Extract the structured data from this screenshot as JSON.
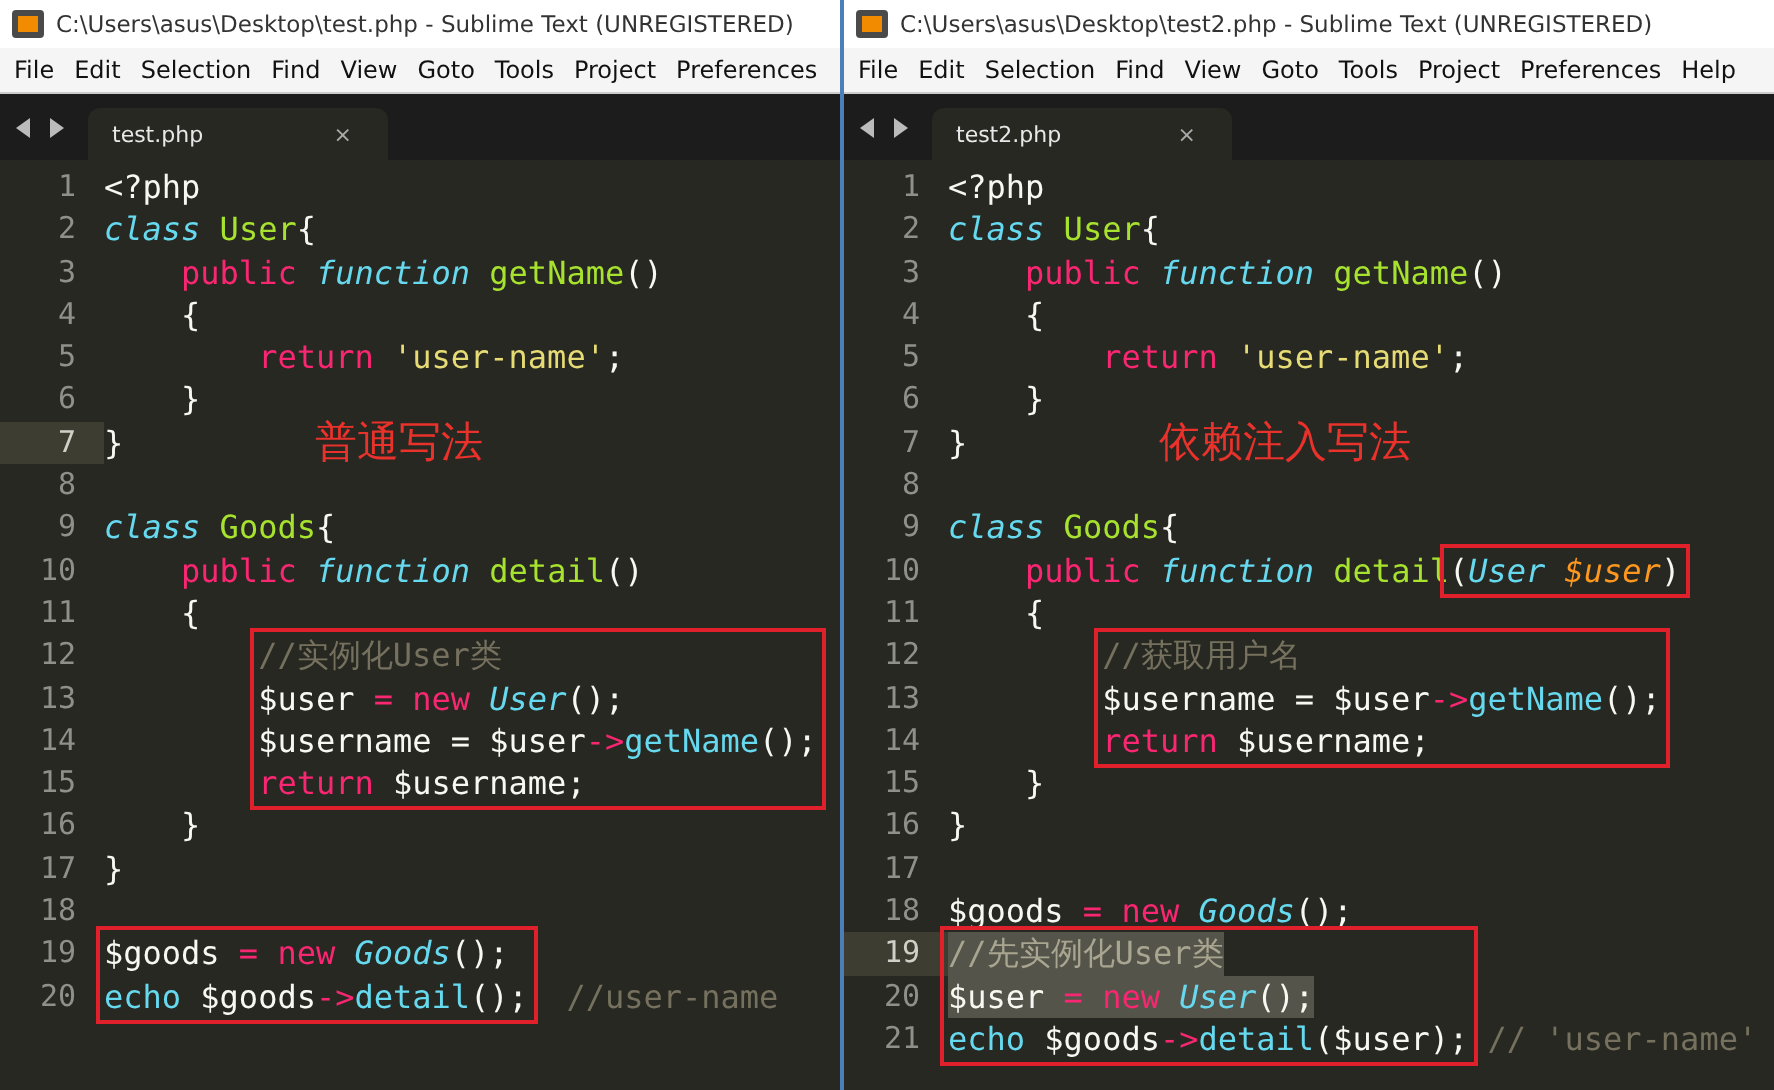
{
  "windows": [
    {
      "title": "C:\\Users\\asus\\Desktop\\test.php - Sublime Text (UNREGISTERED)",
      "menu": [
        "File",
        "Edit",
        "Selection",
        "Find",
        "View",
        "Goto",
        "Tools",
        "Project",
        "Preferences"
      ],
      "tab": {
        "label": "test.php",
        "close": "×",
        "selected": true
      },
      "lines": [
        {
          "number": "1",
          "current": false,
          "selected": false,
          "tokens": [
            {
              "kind": "plain",
              "text": "<?php"
            }
          ]
        },
        {
          "number": "2",
          "current": false,
          "selected": false,
          "tokens": [
            {
              "kind": "storage",
              "text": "class"
            },
            {
              "kind": "entity",
              "text": " User"
            },
            {
              "kind": "plain",
              "text": "{"
            }
          ]
        },
        {
          "number": "3",
          "current": false,
          "selected": false,
          "tokens": [
            {
              "kind": "keyword",
              "text": "    public"
            },
            {
              "kind": "storage",
              "text": " function"
            },
            {
              "kind": "entity",
              "text": " getName"
            },
            {
              "kind": "plain",
              "text": "()"
            }
          ]
        },
        {
          "number": "4",
          "current": false,
          "selected": false,
          "tokens": [
            {
              "kind": "plain",
              "text": "    {"
            }
          ]
        },
        {
          "number": "5",
          "current": false,
          "selected": false,
          "tokens": [
            {
              "kind": "keyword",
              "text": "        return"
            },
            {
              "kind": "string",
              "text": " 'user-name'"
            },
            {
              "kind": "plain",
              "text": ";"
            }
          ]
        },
        {
          "number": "6",
          "current": false,
          "selected": false,
          "tokens": [
            {
              "kind": "plain",
              "text": "    }"
            }
          ]
        },
        {
          "number": "7",
          "current": true,
          "selected": false,
          "tokens": [
            {
              "kind": "plain",
              "text": "}"
            }
          ],
          "note": "普通写法"
        },
        {
          "number": "8",
          "current": false
        },
        {
          "number": "9",
          "current": false,
          "selected": false,
          "tokens": [
            {
              "kind": "storage",
              "text": "class"
            },
            {
              "kind": "entity",
              "text": " Goods"
            },
            {
              "kind": "plain",
              "text": "{"
            }
          ]
        },
        {
          "number": "10",
          "current": false,
          "selected": false,
          "tokens": [
            {
              "kind": "keyword",
              "text": "    public"
            },
            {
              "kind": "storage",
              "text": " function"
            },
            {
              "kind": "entity",
              "text": " detail"
            },
            {
              "kind": "plain",
              "text": "()"
            }
          ]
        },
        {
          "number": "11",
          "current": false,
          "selected": false,
          "tokens": [
            {
              "kind": "plain",
              "text": "    {"
            }
          ]
        },
        {
          "number": "12",
          "current": false,
          "selected": false,
          "tokens": [
            {
              "kind": "comment",
              "text": "        //实例化User类",
              "boxed": true
            }
          ]
        },
        {
          "number": "13",
          "current": false,
          "selected": false,
          "tokens": [
            {
              "kind": "plain",
              "text": "        $user",
              "boxed": true
            },
            {
              "kind": "operator",
              "text": " ="
            },
            {
              "kind": "keyword",
              "text": " new"
            },
            {
              "kind": "type",
              "text": " User"
            },
            {
              "kind": "plain",
              "text": "();"
            }
          ]
        },
        {
          "number": "14",
          "current": false,
          "selected": false,
          "tokens": [
            {
              "kind": "plain",
              "text": "        $username = $user",
              "boxed": true
            },
            {
              "kind": "operator",
              "text": "->"
            },
            {
              "kind": "call",
              "text": "getName"
            },
            {
              "kind": "plain",
              "text": "();",
              "boxed": true
            }
          ]
        },
        {
          "number": "15",
          "current": false,
          "selected": false,
          "tokens": [
            {
              "kind": "keyword",
              "text": "        return",
              "boxed": true
            },
            {
              "kind": "plain",
              "text": " $username;"
            }
          ]
        },
        {
          "number": "16",
          "current": false,
          "selected": false,
          "tokens": [
            {
              "kind": "plain",
              "text": "    }"
            }
          ]
        },
        {
          "number": "17",
          "current": false,
          "selected": false,
          "tokens": [
            {
              "kind": "plain",
              "text": "}"
            }
          ]
        },
        {
          "number": "18",
          "current": false
        },
        {
          "number": "19",
          "current": false,
          "selected": false,
          "tokens": [
            {
              "kind": "plain",
              "text": "$goods",
              "boxed": true
            },
            {
              "kind": "operator",
              "text": " ="
            },
            {
              "kind": "keyword",
              "text": " new"
            },
            {
              "kind": "type",
              "text": " Goods"
            },
            {
              "kind": "plain",
              "text": "();",
              "boxed": true
            }
          ]
        },
        {
          "number": "20",
          "current": false,
          "selected": false,
          "tokens": [
            {
              "kind": "support",
              "text": "echo",
              "boxed": true
            },
            {
              "kind": "plain",
              "text": " $goods"
            },
            {
              "kind": "operator",
              "text": "->"
            },
            {
              "kind": "call",
              "text": "detail"
            },
            {
              "kind": "plain",
              "text": "();",
              "boxed": true
            },
            {
              "kind": "comment",
              "text": "  //user-name"
            }
          ]
        }
      ]
    },
    {
      "title": "C:\\Users\\asus\\Desktop\\test2.php - Sublime Text (UNREGISTERED)",
      "menu": [
        "File",
        "Edit",
        "Selection",
        "Find",
        "View",
        "Goto",
        "Tools",
        "Project",
        "Preferences",
        "Help"
      ],
      "tab": {
        "label": "test2.php",
        "close": "×",
        "selected": true
      },
      "lines": [
        {
          "number": "1",
          "current": false,
          "selected": false,
          "tokens": [
            {
              "kind": "plain",
              "text": "<?php"
            }
          ]
        },
        {
          "number": "2",
          "current": false,
          "selected": false,
          "tokens": [
            {
              "kind": "storage",
              "text": "class"
            },
            {
              "kind": "entity",
              "text": " User"
            },
            {
              "kind": "plain",
              "text": "{"
            }
          ]
        },
        {
          "number": "3",
          "current": false,
          "selected": false,
          "tokens": [
            {
              "kind": "keyword",
              "text": "    public"
            },
            {
              "kind": "storage",
              "text": " function"
            },
            {
              "kind": "entity",
              "text": " getName"
            },
            {
              "kind": "plain",
              "text": "()"
            }
          ]
        },
        {
          "number": "4",
          "current": false,
          "selected": false,
          "tokens": [
            {
              "kind": "plain",
              "text": "    {"
            }
          ]
        },
        {
          "number": "5",
          "current": false,
          "selected": false,
          "tokens": [
            {
              "kind": "keyword",
              "text": "        return"
            },
            {
              "kind": "string",
              "text": " 'user-name'"
            },
            {
              "kind": "plain",
              "text": ";"
            }
          ]
        },
        {
          "number": "6",
          "current": false,
          "selected": false,
          "tokens": [
            {
              "kind": "plain",
              "text": "    }"
            }
          ]
        },
        {
          "number": "7",
          "current": false,
          "selected": false,
          "tokens": [
            {
              "kind": "plain",
              "text": "}"
            }
          ],
          "note": "依赖注入写法"
        },
        {
          "number": "8",
          "current": false
        },
        {
          "number": "9",
          "current": false,
          "selected": false,
          "tokens": [
            {
              "kind": "storage",
              "text": "class"
            },
            {
              "kind": "entity",
              "text": " Goods"
            },
            {
              "kind": "plain",
              "text": "{"
            }
          ]
        },
        {
          "number": "10",
          "current": false,
          "selected": false,
          "tokens": [
            {
              "kind": "keyword",
              "text": "    public"
            },
            {
              "kind": "storage",
              "text": " function"
            },
            {
              "kind": "entity",
              "text": " detail"
            },
            {
              "kind": "plain",
              "text": "(",
              "boxed": true
            },
            {
              "kind": "type",
              "text": "User"
            },
            {
              "kind": "param",
              "text": " $user"
            },
            {
              "kind": "plain",
              "text": ")",
              "boxed": true
            }
          ]
        },
        {
          "number": "11",
          "current": false,
          "selected": false,
          "tokens": [
            {
              "kind": "plain",
              "text": "    {"
            }
          ]
        },
        {
          "number": "12",
          "current": false,
          "selected": false,
          "tokens": [
            {
              "kind": "comment",
              "text": "        //获取用户名",
              "boxed": true
            }
          ]
        },
        {
          "number": "13",
          "current": false,
          "selected": false,
          "tokens": [
            {
              "kind": "plain",
              "text": "        $username = $user",
              "boxed": true
            },
            {
              "kind": "operator",
              "text": "->"
            },
            {
              "kind": "call",
              "text": "getName"
            },
            {
              "kind": "plain",
              "text": "();",
              "boxed": true
            }
          ]
        },
        {
          "number": "14",
          "current": false,
          "selected": false,
          "tokens": [
            {
              "kind": "keyword",
              "text": "        return",
              "boxed": true
            },
            {
              "kind": "plain",
              "text": " $username;"
            }
          ]
        },
        {
          "number": "15",
          "current": false,
          "selected": false,
          "tokens": [
            {
              "kind": "plain",
              "text": "    }"
            }
          ]
        },
        {
          "number": "16",
          "current": false,
          "selected": false,
          "tokens": [
            {
              "kind": "plain",
              "text": "}"
            }
          ]
        },
        {
          "number": "17",
          "current": false
        },
        {
          "number": "18",
          "current": false,
          "selected": false,
          "tokens": [
            {
              "kind": "plain",
              "text": "$goods"
            },
            {
              "kind": "operator",
              "text": " ="
            },
            {
              "kind": "keyword",
              "text": " new"
            },
            {
              "kind": "type",
              "text": " Goods"
            },
            {
              "kind": "plain",
              "text": "();"
            }
          ]
        },
        {
          "number": "19",
          "current": true,
          "selected": true,
          "tokens": [
            {
              "kind": "comment",
              "text": "//先实例化User类",
              "boxed": true
            }
          ]
        },
        {
          "number": "20",
          "current": false,
          "selected": true,
          "tokens": [
            {
              "kind": "plain",
              "text": "$user",
              "boxed": true
            },
            {
              "kind": "operator",
              "text": " ="
            },
            {
              "kind": "keyword",
              "text": " new"
            },
            {
              "kind": "type",
              "text": " User"
            },
            {
              "kind": "plain",
              "text": "();"
            }
          ]
        },
        {
          "number": "21",
          "current": false,
          "selected": false,
          "tokens": [
            {
              "kind": "support",
              "text": "echo",
              "boxed": true
            },
            {
              "kind": "plain",
              "text": " $goods"
            },
            {
              "kind": "operator",
              "text": "->"
            },
            {
              "kind": "call",
              "text": "detail"
            },
            {
              "kind": "plain",
              "text": "($user);",
              "boxed": true
            },
            {
              "kind": "comment",
              "text": " // 'user-name'"
            }
          ]
        }
      ]
    }
  ]
}
